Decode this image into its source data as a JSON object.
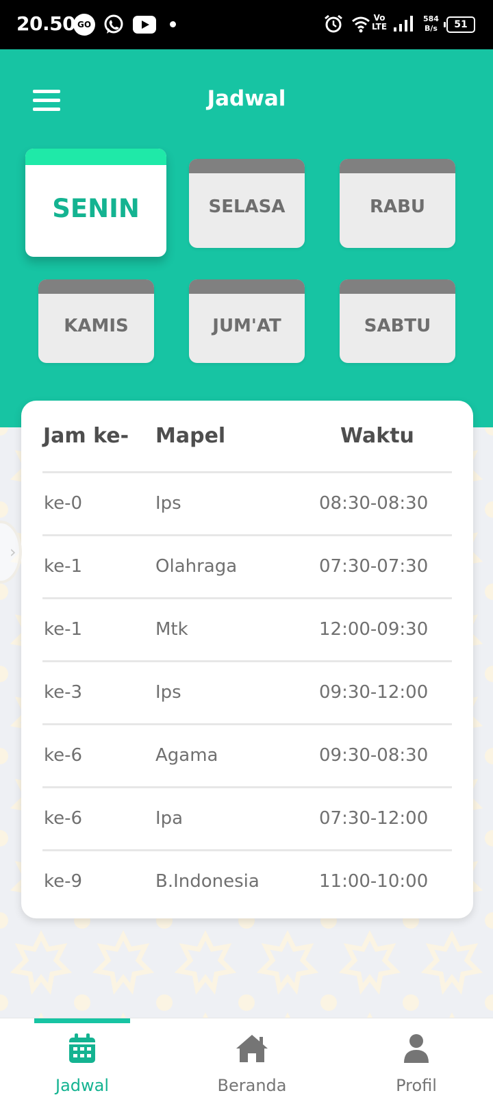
{
  "status_bar": {
    "time": "20.50",
    "go_badge": "GO",
    "network_top": "Vo",
    "network_bottom": "LTE",
    "speed_value": "584",
    "speed_unit": "B/s",
    "battery": "51"
  },
  "header": {
    "title": "Jadwal"
  },
  "days": [
    {
      "label": "SENIN",
      "active": true
    },
    {
      "label": "SELASA",
      "active": false
    },
    {
      "label": "RABU",
      "active": false
    },
    {
      "label": "KAMIS",
      "active": false
    },
    {
      "label": "JUM'AT",
      "active": false
    },
    {
      "label": "SABTU",
      "active": false
    }
  ],
  "schedule": {
    "columns": [
      "Jam ke-",
      "Mapel",
      "Waktu"
    ],
    "rows": [
      {
        "jam": "ke-0",
        "mapel": "Ips",
        "waktu": "08:30-08:30"
      },
      {
        "jam": "ke-1",
        "mapel": "Olahraga",
        "waktu": "07:30-07:30"
      },
      {
        "jam": "ke-1",
        "mapel": "Mtk",
        "waktu": "12:00-09:30"
      },
      {
        "jam": "ke-3",
        "mapel": "Ips",
        "waktu": "09:30-12:00"
      },
      {
        "jam": "ke-6",
        "mapel": "Agama",
        "waktu": "09:30-08:30"
      },
      {
        "jam": "ke-6",
        "mapel": "Ipa",
        "waktu": "07:30-12:00"
      },
      {
        "jam": "ke-9",
        "mapel": "B.Indonesia",
        "waktu": "11:00-10:00"
      }
    ]
  },
  "bottom_nav": {
    "items": [
      {
        "label": "Jadwal",
        "icon": "calendar-icon",
        "active": true
      },
      {
        "label": "Beranda",
        "icon": "home-icon",
        "active": false
      },
      {
        "label": "Profil",
        "icon": "user-icon",
        "active": false
      }
    ]
  },
  "colors": {
    "primary": "#17c4a3",
    "active_text": "#14b391",
    "active_cap": "#1fe9a8"
  }
}
